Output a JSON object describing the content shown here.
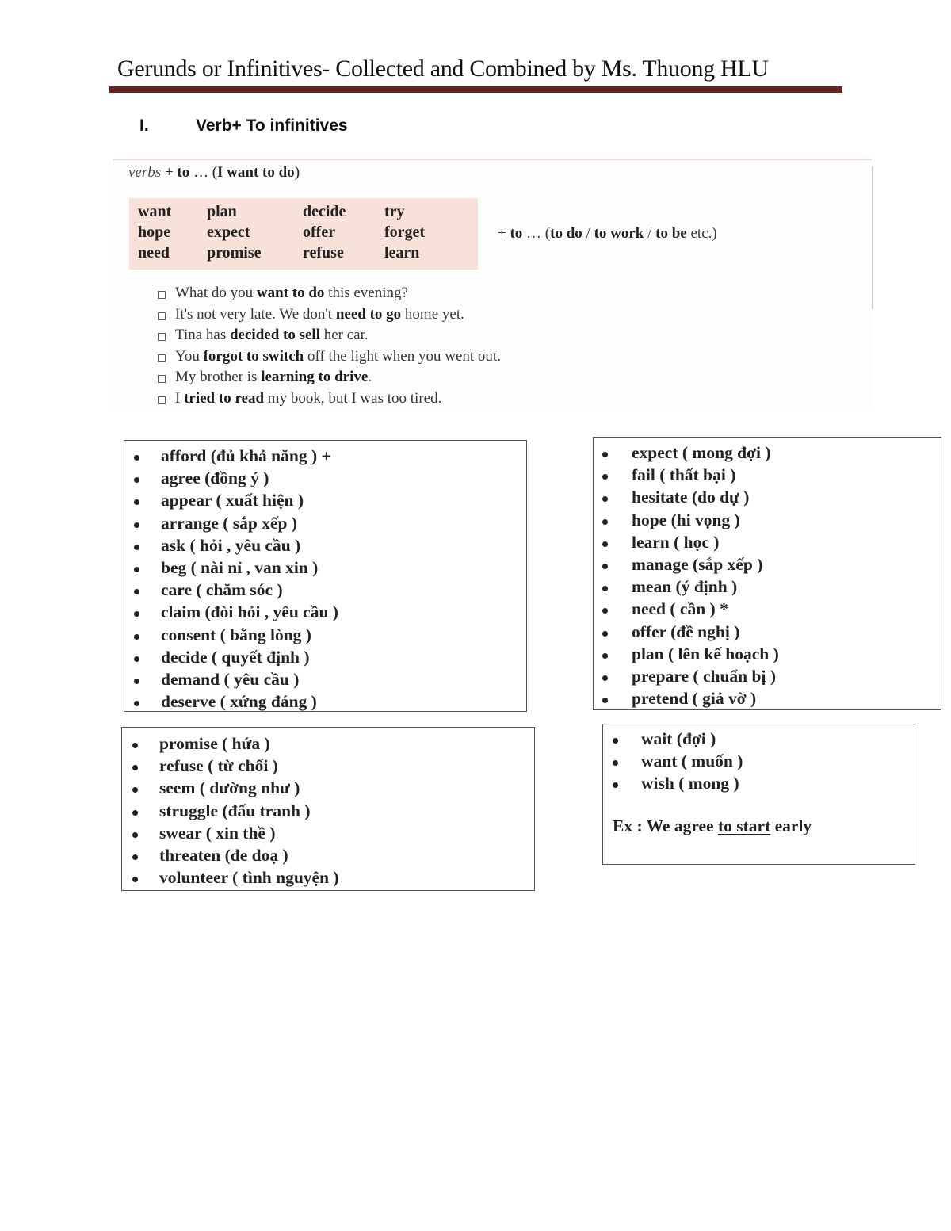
{
  "header": {
    "title": "Gerunds or Infinitives- Collected and Combined by Ms. Thuong HLU",
    "rule_color": "#632322"
  },
  "section": {
    "number": "I.",
    "title": "Verb+ To infinitives"
  },
  "scan": {
    "pattern": {
      "italic": "verbs",
      "middle": " + ",
      "bold_to": "to",
      "rest": " … (",
      "bold_example": "I want to do",
      "close": ")"
    },
    "verb_grid": [
      [
        "want",
        "plan",
        "decide",
        "try"
      ],
      [
        "hope",
        "expect",
        "offer",
        "forget"
      ],
      [
        "need",
        "promise",
        "refuse",
        "learn"
      ]
    ],
    "suffix": {
      "plus": "+ ",
      "to": "to",
      "ellipsis": " … (",
      "to_do": "to do",
      "sep1": " / ",
      "to_work": "to work",
      "sep2": " / ",
      "to_be": "to be",
      "etc": " etc.)"
    },
    "examples": [
      {
        "pre": "What do you ",
        "bold": "want to do",
        "post": " this evening?"
      },
      {
        "pre": "It's not very late.  We don't ",
        "bold": "need to go",
        "post": " home yet."
      },
      {
        "pre": "Tina has ",
        "bold": "decided to sell",
        "post": " her car."
      },
      {
        "pre": "You ",
        "bold": "forgot to switch",
        "post": " off the light when you went out."
      },
      {
        "pre": "My brother is ",
        "bold": "learning to drive",
        "post": "."
      },
      {
        "pre": "I ",
        "bold": "tried to read",
        "post": " my book, but I was too tired."
      }
    ],
    "highlight_color": "#f8e1d8"
  },
  "lists": {
    "box_a": [
      "afford (đủ khả năng ) +",
      "agree (đồng ý )",
      "appear ( xuất hiện )",
      "arrange ( sắp xếp )",
      "ask ( hỏi , yêu cầu )",
      "beg ( nài nỉ , van xin )",
      "care ( chăm sóc )",
      "claim (đòi hỏi , yêu cầu )",
      "consent ( bằng lòng )",
      "decide ( quyết định )",
      "demand ( yêu cầu )",
      "deserve ( xứng đáng )"
    ],
    "box_b": [
      "expect ( mong đợi )",
      "fail ( thất bại )",
      "hesitate (do dự )",
      "hope (hi vọng )",
      "learn ( học )",
      "manage (sắp xếp )",
      "mean (ý định )",
      "need ( cần )   *",
      "offer (đề nghị )",
      "plan ( lên kế hoạch )",
      "prepare ( chuẩn bị )",
      "pretend ( giả vờ )"
    ],
    "box_c": [
      "promise ( hứa )",
      "refuse ( từ chối )",
      "seem ( dường như )",
      "struggle (đấu tranh )",
      "swear ( xin thề )",
      "threaten (đe doạ )",
      "volunteer ( tình nguyện )"
    ],
    "box_d": [
      "wait (đợi )",
      "want ( muốn )",
      "wish ( mong )"
    ],
    "example": {
      "pre": "Ex : We agree ",
      "underlined": "to start",
      "post": " early"
    }
  }
}
